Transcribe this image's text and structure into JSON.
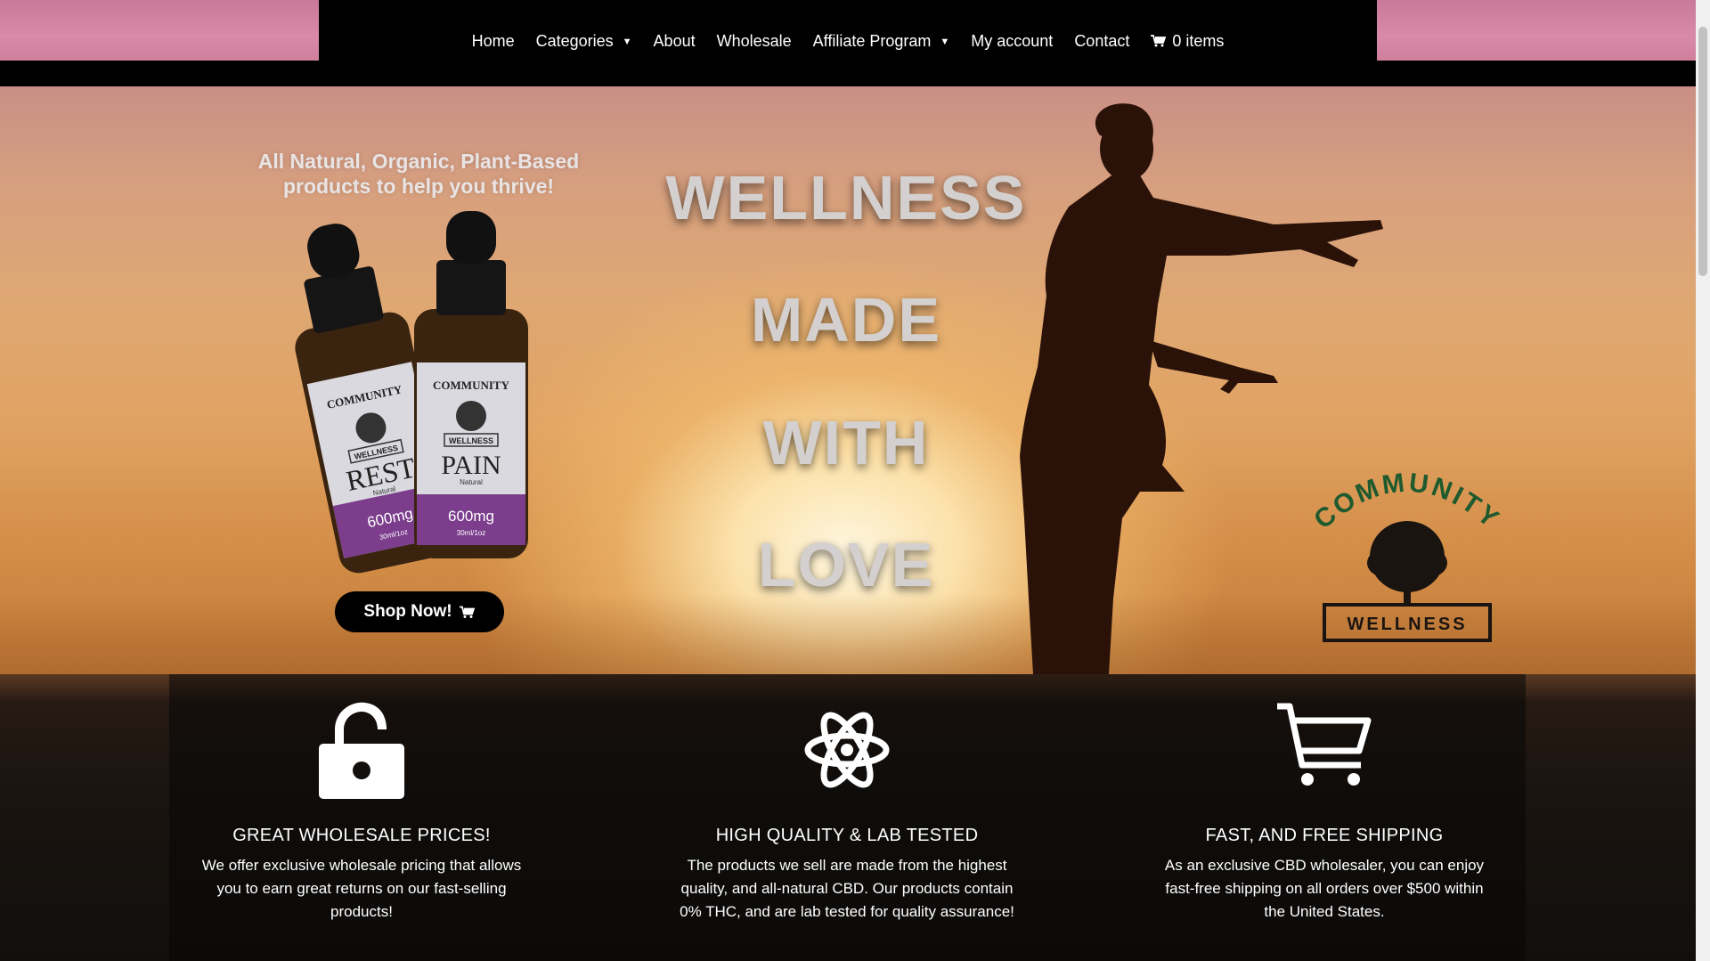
{
  "nav": {
    "items": [
      {
        "label": "Home",
        "dropdown": false
      },
      {
        "label": "Categories",
        "dropdown": true
      },
      {
        "label": "About",
        "dropdown": false
      },
      {
        "label": "Wholesale",
        "dropdown": false
      },
      {
        "label": "Affiliate Program",
        "dropdown": true
      },
      {
        "label": "My account",
        "dropdown": false
      },
      {
        "label": "Contact",
        "dropdown": false
      }
    ],
    "cart_label": "0 items",
    "cart_icon": "shopping-cart-icon"
  },
  "hero": {
    "subtitle_line1": "All Natural, Organic, Plant-Based",
    "subtitle_line2": "products to help you thrive!",
    "headline_words": [
      "WELLNESS",
      "MADE",
      "WITH",
      "LOVE"
    ],
    "shop_button": "Shop Now!",
    "bottles": [
      {
        "brand": "COMMUNITY",
        "band": "WELLNESS",
        "name": "REST",
        "variant": "Natural",
        "dose": "600mg",
        "size": "30ml/1oz"
      },
      {
        "brand": "COMMUNITY",
        "band": "WELLNESS",
        "name": "PAIN",
        "variant": "Natural",
        "dose": "600mg",
        "size": "30ml/1oz"
      }
    ],
    "logo": {
      "top": "COMMUNITY",
      "bottom": "WELLNESS"
    }
  },
  "features": [
    {
      "icon": "unlocked-padlock-icon",
      "title": "GREAT WHOLESALE PRICES!",
      "text": "We offer exclusive wholesale pricing that allows you to earn great returns on our fast-selling products!"
    },
    {
      "icon": "atom-icon",
      "title": "HIGH QUALITY & LAB TESTED",
      "text": "The products we sell are made from the highest quality, and all-natural CBD. Our products contain 0% THC, and are lab tested for quality assurance!"
    },
    {
      "icon": "shopping-cart-icon",
      "title": "FAST, AND FREE SHIPPING",
      "text": "As an exclusive CBD wholesaler, you can enjoy fast-free shipping on all orders over $500 within the United States."
    }
  ],
  "colors": {
    "nav_bg": "#000000",
    "pink_banner": "#d98aa6",
    "bottle_purple": "#7b3d8c",
    "logo_green": "#1f5a2e",
    "hero_text": "#d4d0cf"
  }
}
